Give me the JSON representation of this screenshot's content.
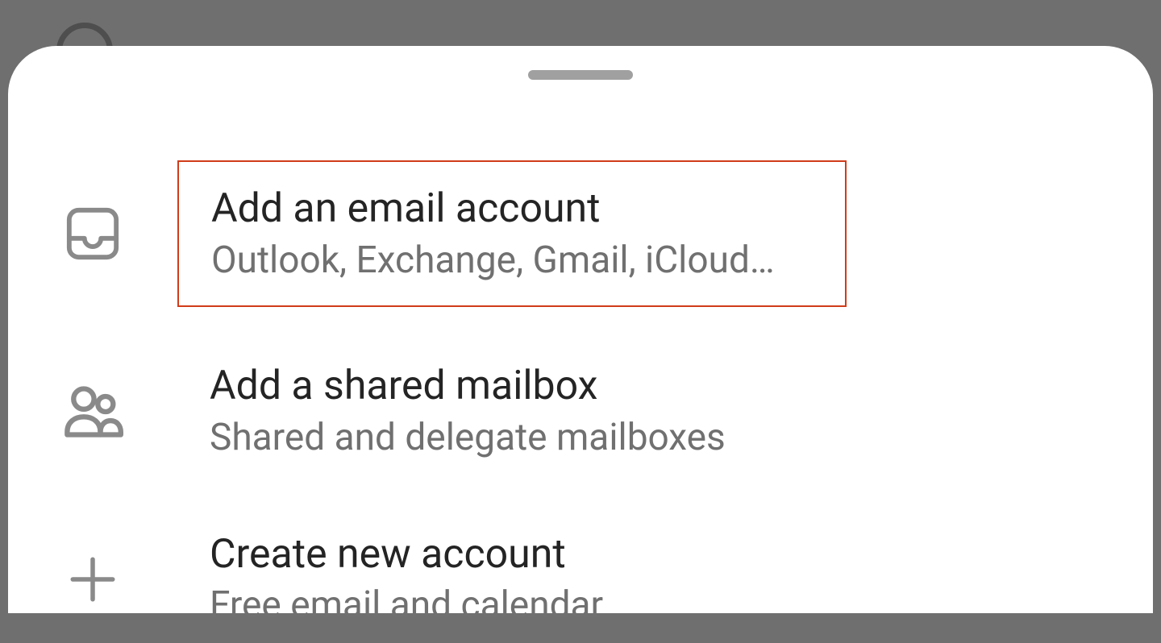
{
  "options": [
    {
      "icon": "inbox",
      "title": "Add an email account",
      "subtitle": "Outlook, Exchange, Gmail, iCloud…",
      "highlighted": true
    },
    {
      "icon": "people",
      "title": "Add a shared mailbox",
      "subtitle": "Shared and delegate mailboxes",
      "highlighted": false
    },
    {
      "icon": "plus",
      "title": "Create new account",
      "subtitle": "Free email and calendar",
      "highlighted": false
    }
  ],
  "colors": {
    "highlight_border": "#d13c19",
    "sheet_bg": "#ffffff",
    "backdrop": "#6f6f6f",
    "title_text": "#242424",
    "sub_text": "#707070",
    "icon_stroke": "#8a8a8a"
  }
}
